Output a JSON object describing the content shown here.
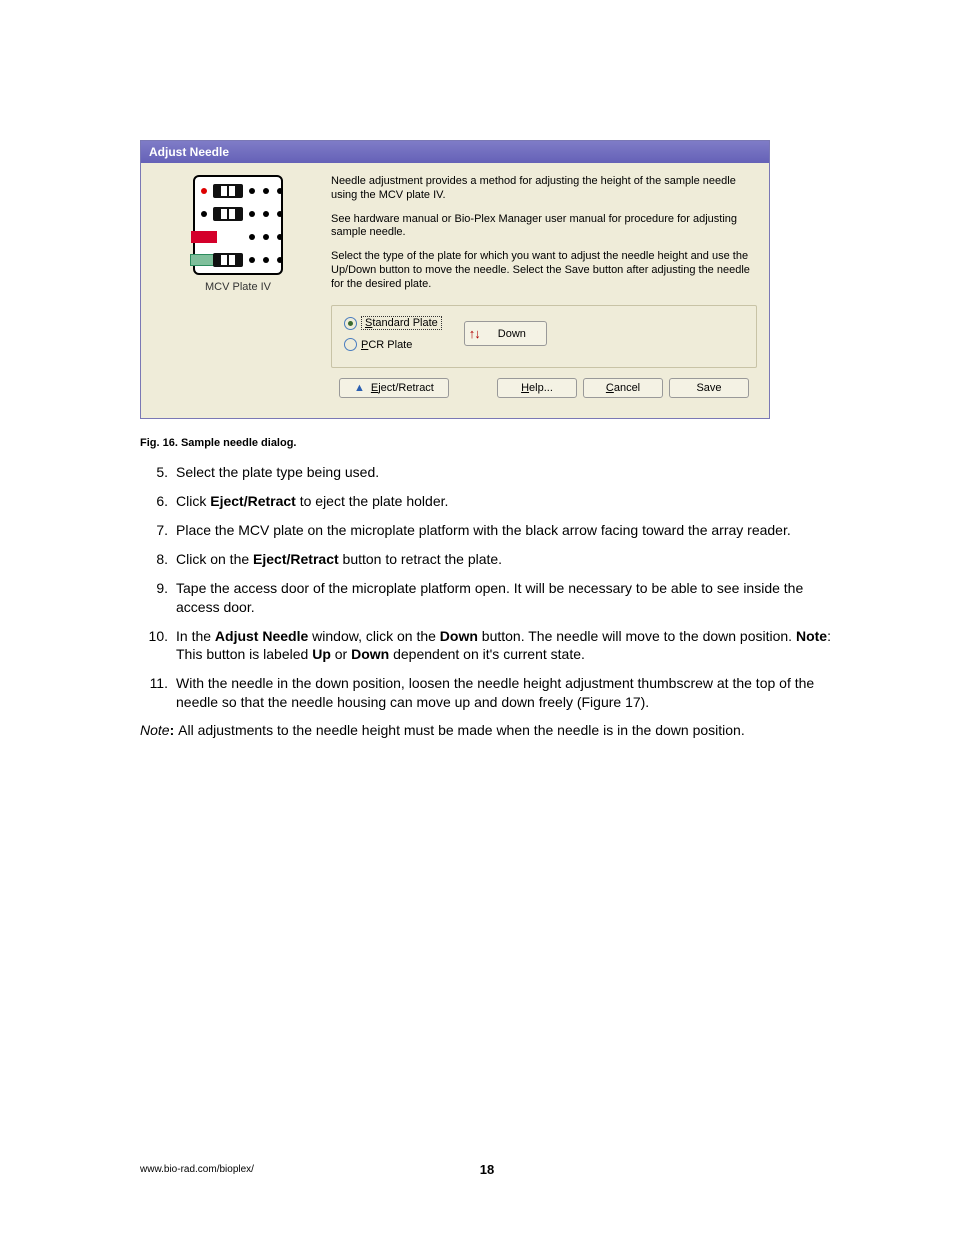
{
  "dialog": {
    "title": "Adjust Needle",
    "plate_caption": "MCV Plate IV",
    "para1": "Needle adjustment provides a method for adjusting the height of the sample needle using the MCV plate IV.",
    "para2": "See hardware manual or Bio-Plex Manager user manual for procedure for adjusting sample needle.",
    "para3": "Select the type of the plate for which you want to adjust the needle height and use the Up/Down button to move the needle. Select the Save button after adjusting the needle for the desired plate.",
    "radio_std_pre": "S",
    "radio_std_rest": "tandard Plate",
    "radio_pcr_pre": "P",
    "radio_pcr_rest": "CR Plate",
    "down_label": "Down",
    "eject_pre": "E",
    "eject_rest": "ject/Retract",
    "help_pre": "H",
    "help_rest": "elp...",
    "cancel_pre": "C",
    "cancel_rest": "ancel",
    "save_label": "Save"
  },
  "caption": "Fig. 16.  Sample needle dialog.",
  "steps": {
    "n5": "5.",
    "t5": "Select the plate type being used.",
    "n6": "6.",
    "t6a": "Click ",
    "t6b": "Eject/Retract",
    "t6c": " to eject the plate holder.",
    "n7": "7.",
    "t7": "Place the MCV plate on the microplate platform with the black arrow facing toward the array reader.",
    "n8": "8.",
    "t8a": "Click on the ",
    "t8b": "Eject/Retract",
    "t8c": " button to retract the plate.",
    "n9": "9.",
    "t9": "Tape the access door of the microplate platform open. It will be necessary to be able to see inside the access door.",
    "n10": "10.",
    "t10a": "In the ",
    "t10b": "Adjust Needle",
    "t10c": " window, click on the ",
    "t10d": "Down",
    "t10e": " button. The needle will move to the down position. ",
    "t10f": "Note",
    "t10g": ": This button is labeled ",
    "t10h": "Up",
    "t10i": " or ",
    "t10j": "Down",
    "t10k": " dependent on it's current state.",
    "n11": "11.",
    "t11": "With the needle in the down position, loosen the needle height adjustment thumbscrew at the top of the needle so that the needle housing can move up and down freely (Figure 17)."
  },
  "note": {
    "lead": "Note",
    "colon": ": ",
    "text": "All adjustments to the needle height must be made when the needle is in the down position."
  },
  "footer": {
    "url": "www.bio-rad.com/bioplex/",
    "pagenum": "18"
  }
}
